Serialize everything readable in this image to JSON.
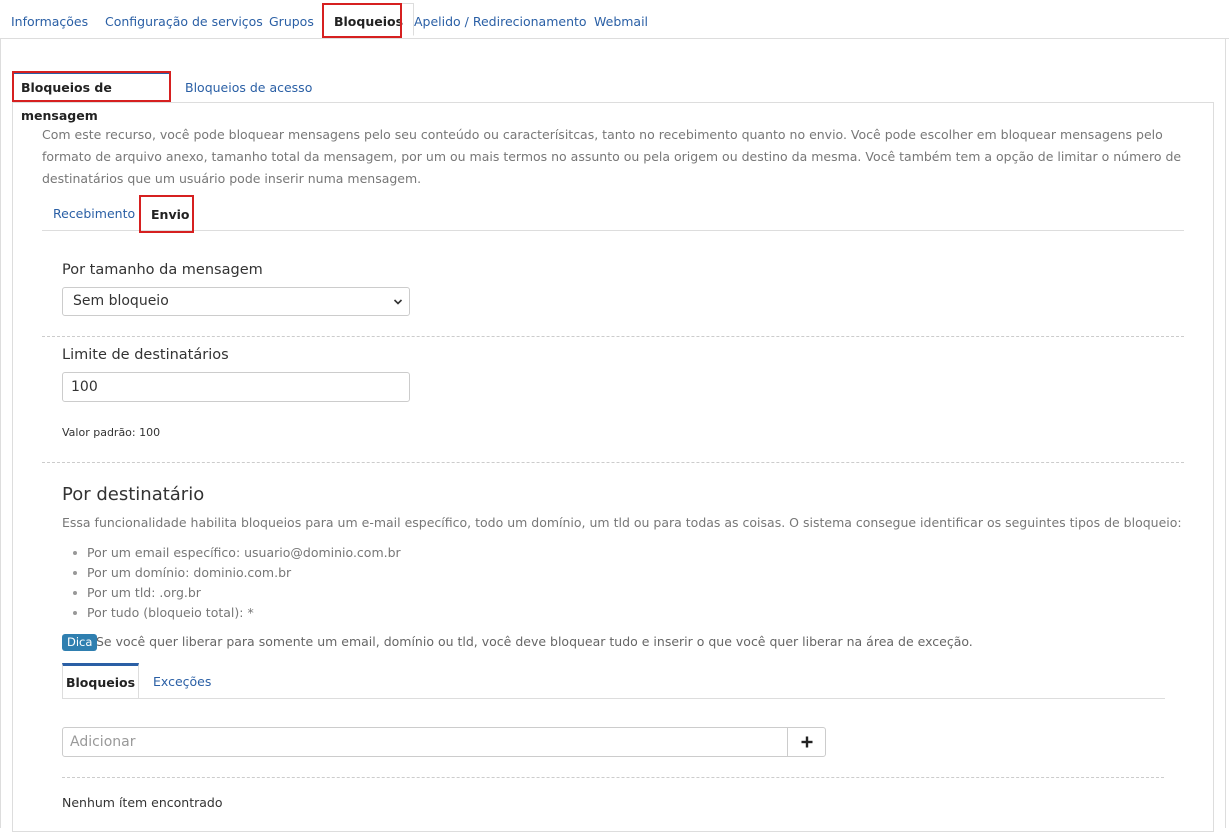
{
  "top_nav": {
    "tabs": [
      "Informações",
      "Configuração de serviços",
      "Grupos",
      "Bloqueios",
      "Apelido / Redirecionamento",
      "Webmail"
    ]
  },
  "sub_tabs": [
    "Bloqueios de mensagem",
    "Bloqueios de acesso"
  ],
  "description": "Com este recurso, você pode bloquear mensagens pelo seu conteúdo ou caracterísitcas, tanto no recebimento quanto no envio. Você pode escolher em bloquear mensagens pelo formato de arquivo anexo, tamanho total da mensagem, por um ou mais termos no assunto ou pela origem ou destino da mesma. Você também tem a opção de limitar o número de destinatários que um usuário pode inserir numa mensagem.",
  "direction_tabs": [
    "Recebimento",
    "Envio"
  ],
  "size_block": {
    "label": "Por tamanho da mensagem",
    "selected": "Sem bloqueio"
  },
  "recipient_limit": {
    "label": "Limite de destinatários",
    "value": "100",
    "help": "Valor padrão: 100"
  },
  "by_recipient": {
    "heading": "Por destinatário",
    "intro": "Essa funcionalidade habilita bloqueios para um e-mail específico, todo um domínio, um tld ou para todas as coisas. O sistema consegue identificar os seguintes tipos de bloqueio:",
    "items": [
      "Por um email específico: usuario@dominio.com.br",
      "Por um domínio: dominio.com.br",
      "Por um tld: .org.br",
      "Por tudo (bloqueio total): *"
    ],
    "tip_badge": "Dica",
    "tip_text": "Se você quer liberar para somente um email, domínio ou tld, você deve bloquear tudo e inserir o que você quer liberar na área de exceção."
  },
  "block_tabs": [
    "Bloqueios",
    "Exceções"
  ],
  "add": {
    "placeholder": "Adicionar"
  },
  "empty_message": "Nenhum ítem encontrado",
  "colors": {
    "link": "#2a5fa5",
    "highlight": "#d62020",
    "badge": "#2f7fb0"
  }
}
